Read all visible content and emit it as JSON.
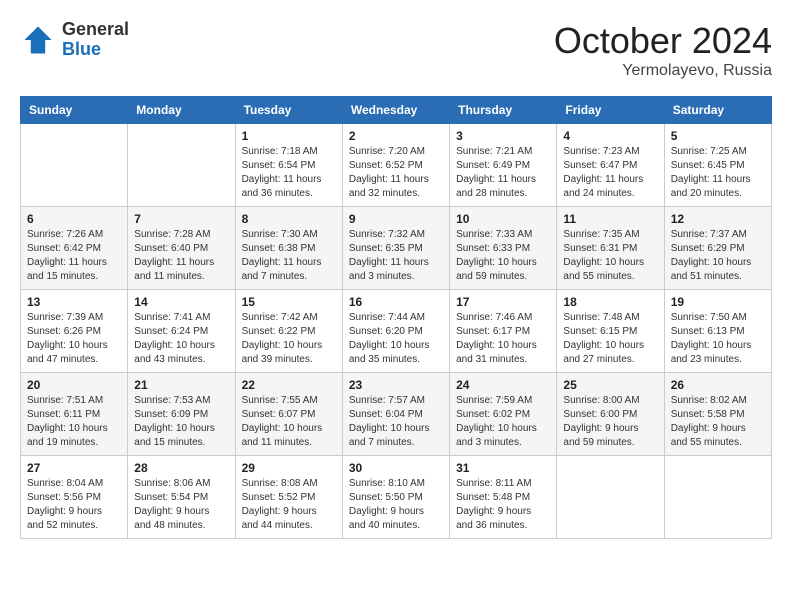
{
  "header": {
    "logo_general": "General",
    "logo_blue": "Blue",
    "month_year": "October 2024",
    "location": "Yermolayevo, Russia"
  },
  "days_of_week": [
    "Sunday",
    "Monday",
    "Tuesday",
    "Wednesday",
    "Thursday",
    "Friday",
    "Saturday"
  ],
  "weeks": [
    [
      {
        "day": "",
        "detail": ""
      },
      {
        "day": "",
        "detail": ""
      },
      {
        "day": "1",
        "detail": "Sunrise: 7:18 AM\nSunset: 6:54 PM\nDaylight: 11 hours\nand 36 minutes."
      },
      {
        "day": "2",
        "detail": "Sunrise: 7:20 AM\nSunset: 6:52 PM\nDaylight: 11 hours\nand 32 minutes."
      },
      {
        "day": "3",
        "detail": "Sunrise: 7:21 AM\nSunset: 6:49 PM\nDaylight: 11 hours\nand 28 minutes."
      },
      {
        "day": "4",
        "detail": "Sunrise: 7:23 AM\nSunset: 6:47 PM\nDaylight: 11 hours\nand 24 minutes."
      },
      {
        "day": "5",
        "detail": "Sunrise: 7:25 AM\nSunset: 6:45 PM\nDaylight: 11 hours\nand 20 minutes."
      }
    ],
    [
      {
        "day": "6",
        "detail": "Sunrise: 7:26 AM\nSunset: 6:42 PM\nDaylight: 11 hours\nand 15 minutes."
      },
      {
        "day": "7",
        "detail": "Sunrise: 7:28 AM\nSunset: 6:40 PM\nDaylight: 11 hours\nand 11 minutes."
      },
      {
        "day": "8",
        "detail": "Sunrise: 7:30 AM\nSunset: 6:38 PM\nDaylight: 11 hours\nand 7 minutes."
      },
      {
        "day": "9",
        "detail": "Sunrise: 7:32 AM\nSunset: 6:35 PM\nDaylight: 11 hours\nand 3 minutes."
      },
      {
        "day": "10",
        "detail": "Sunrise: 7:33 AM\nSunset: 6:33 PM\nDaylight: 10 hours\nand 59 minutes."
      },
      {
        "day": "11",
        "detail": "Sunrise: 7:35 AM\nSunset: 6:31 PM\nDaylight: 10 hours\nand 55 minutes."
      },
      {
        "day": "12",
        "detail": "Sunrise: 7:37 AM\nSunset: 6:29 PM\nDaylight: 10 hours\nand 51 minutes."
      }
    ],
    [
      {
        "day": "13",
        "detail": "Sunrise: 7:39 AM\nSunset: 6:26 PM\nDaylight: 10 hours\nand 47 minutes."
      },
      {
        "day": "14",
        "detail": "Sunrise: 7:41 AM\nSunset: 6:24 PM\nDaylight: 10 hours\nand 43 minutes."
      },
      {
        "day": "15",
        "detail": "Sunrise: 7:42 AM\nSunset: 6:22 PM\nDaylight: 10 hours\nand 39 minutes."
      },
      {
        "day": "16",
        "detail": "Sunrise: 7:44 AM\nSunset: 6:20 PM\nDaylight: 10 hours\nand 35 minutes."
      },
      {
        "day": "17",
        "detail": "Sunrise: 7:46 AM\nSunset: 6:17 PM\nDaylight: 10 hours\nand 31 minutes."
      },
      {
        "day": "18",
        "detail": "Sunrise: 7:48 AM\nSunset: 6:15 PM\nDaylight: 10 hours\nand 27 minutes."
      },
      {
        "day": "19",
        "detail": "Sunrise: 7:50 AM\nSunset: 6:13 PM\nDaylight: 10 hours\nand 23 minutes."
      }
    ],
    [
      {
        "day": "20",
        "detail": "Sunrise: 7:51 AM\nSunset: 6:11 PM\nDaylight: 10 hours\nand 19 minutes."
      },
      {
        "day": "21",
        "detail": "Sunrise: 7:53 AM\nSunset: 6:09 PM\nDaylight: 10 hours\nand 15 minutes."
      },
      {
        "day": "22",
        "detail": "Sunrise: 7:55 AM\nSunset: 6:07 PM\nDaylight: 10 hours\nand 11 minutes."
      },
      {
        "day": "23",
        "detail": "Sunrise: 7:57 AM\nSunset: 6:04 PM\nDaylight: 10 hours\nand 7 minutes."
      },
      {
        "day": "24",
        "detail": "Sunrise: 7:59 AM\nSunset: 6:02 PM\nDaylight: 10 hours\nand 3 minutes."
      },
      {
        "day": "25",
        "detail": "Sunrise: 8:00 AM\nSunset: 6:00 PM\nDaylight: 9 hours\nand 59 minutes."
      },
      {
        "day": "26",
        "detail": "Sunrise: 8:02 AM\nSunset: 5:58 PM\nDaylight: 9 hours\nand 55 minutes."
      }
    ],
    [
      {
        "day": "27",
        "detail": "Sunrise: 8:04 AM\nSunset: 5:56 PM\nDaylight: 9 hours\nand 52 minutes."
      },
      {
        "day": "28",
        "detail": "Sunrise: 8:06 AM\nSunset: 5:54 PM\nDaylight: 9 hours\nand 48 minutes."
      },
      {
        "day": "29",
        "detail": "Sunrise: 8:08 AM\nSunset: 5:52 PM\nDaylight: 9 hours\nand 44 minutes."
      },
      {
        "day": "30",
        "detail": "Sunrise: 8:10 AM\nSunset: 5:50 PM\nDaylight: 9 hours\nand 40 minutes."
      },
      {
        "day": "31",
        "detail": "Sunrise: 8:11 AM\nSunset: 5:48 PM\nDaylight: 9 hours\nand 36 minutes."
      },
      {
        "day": "",
        "detail": ""
      },
      {
        "day": "",
        "detail": ""
      }
    ]
  ]
}
